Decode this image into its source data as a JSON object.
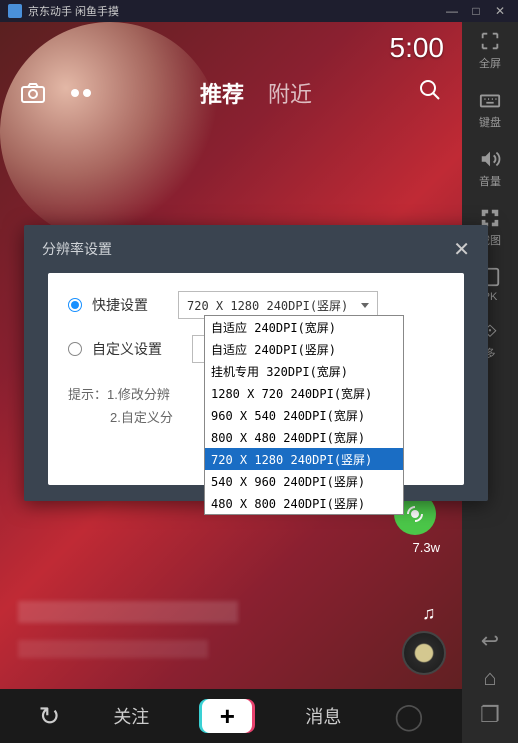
{
  "titlebar": {
    "title": "京东动手 闲鱼手摸"
  },
  "topRight": {
    "timer": "5:00"
  },
  "nav": {
    "tabs": {
      "recommend": "推荐",
      "nearby": "附近"
    }
  },
  "sideToolbar": {
    "fullscreen": "全屏",
    "keyboard": "键盘",
    "volume": "音量",
    "screenshot": "截图",
    "pk": "PK",
    "more": "多"
  },
  "dialog": {
    "title": "分辨率设置",
    "quickSetting": "快捷设置",
    "customSetting": "自定义设置",
    "selectedValue": "720 X 1280 240DPI(竖屏)",
    "hint1": "提示：1.修改分辨",
    "hint2": "2.自定义分"
  },
  "dropdown": {
    "options": [
      "自适应 240DPI(宽屏)",
      "自适应 240DPI(竖屏)",
      "挂机专用 320DPI(宽屏)",
      "1280 X 720 240DPI(宽屏)",
      "960 X 540 240DPI(宽屏)",
      "800 X 480 240DPI(宽屏)",
      "720 X 1280 240DPI(竖屏)",
      "540 X 960 240DPI(竖屏)",
      "480 X 800 240DPI(竖屏)"
    ],
    "selectedIndex": 6
  },
  "video": {
    "shareCount": "7.3w"
  },
  "bottomNav": {
    "follow": "关注",
    "message": "消息"
  }
}
